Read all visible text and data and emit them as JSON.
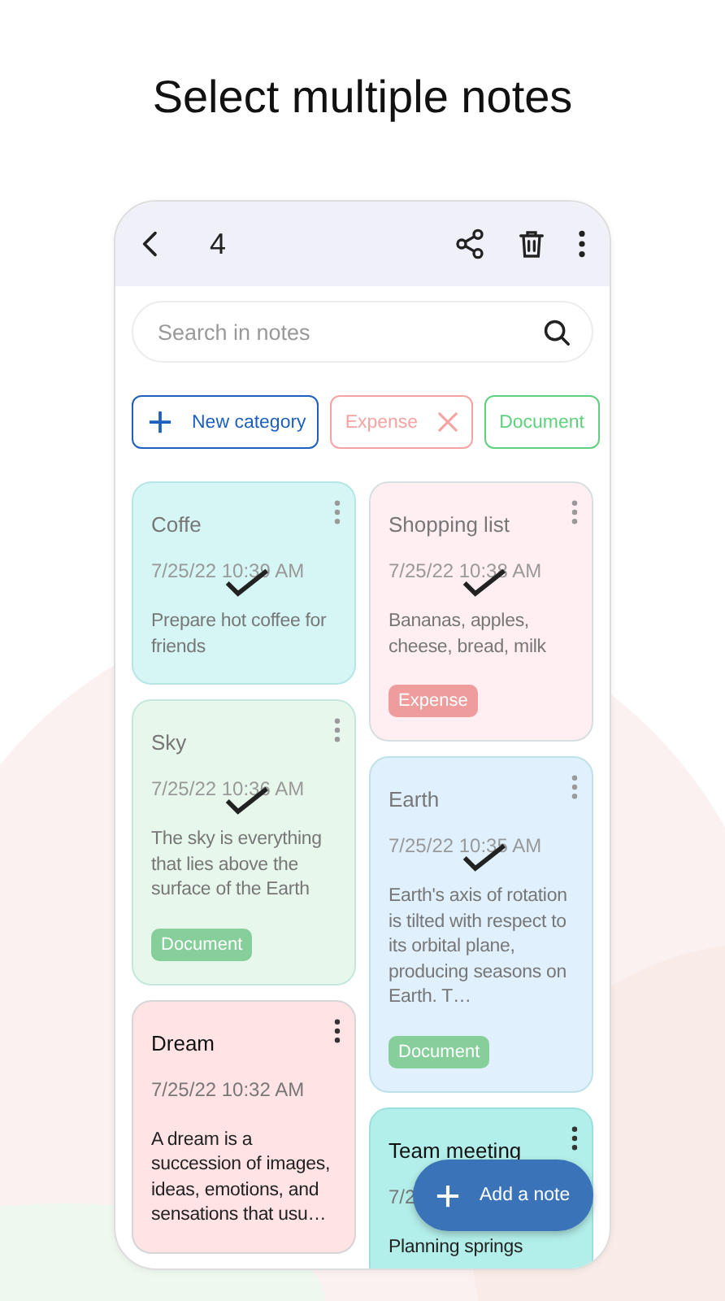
{
  "heading": "Select multiple notes",
  "toolbar": {
    "count": "4"
  },
  "search": {
    "placeholder": "Search in notes"
  },
  "categories": [
    {
      "kind": "new",
      "label": "New category"
    },
    {
      "kind": "tag",
      "label": "Expense",
      "color": "#f5a3a3",
      "removable": true
    },
    {
      "kind": "tag",
      "label": "Document",
      "color": "#5fd07e",
      "removable": false
    }
  ],
  "note_columns": [
    {
      "notes": [
        {
          "title": "Coffe",
          "date": "7/25/22 10:39 AM",
          "body": "Prepare hot coffee for friends",
          "color": "#d6f5f5",
          "selected": true
        },
        {
          "title": "Sky",
          "date": "7/25/22 10:36 AM",
          "body": "The sky is everything that lies above the surface of the Earth",
          "color": "#e8f7ec",
          "selected": true,
          "tag": {
            "label": "Document",
            "color": "#86cf9b"
          }
        },
        {
          "title": "Dream",
          "date": "7/25/22 10:32 AM",
          "body": "A dream is a succession of images, ideas, emotions, and sensations that usu…",
          "color": "#ffe3e5",
          "selected": false
        }
      ]
    },
    {
      "notes": [
        {
          "title": "Shopping list",
          "date": "7/25/22 10:38 AM",
          "body": "Bananas, apples, cheese, bread, milk",
          "color": "#ffeef2",
          "selected": true,
          "tag": {
            "label": "Expense",
            "color": "#ee9c9c"
          }
        },
        {
          "title": "Earth",
          "date": "7/25/22 10:35 AM",
          "body": "Earth's axis of rotation is tilted with respect to its orbital plane, producing seasons on Earth. T…",
          "color": "#e0f0fc",
          "selected": true,
          "tag": {
            "label": "Document",
            "color": "#86cf9b"
          }
        },
        {
          "title": "Team meeting",
          "date": "7/2",
          "body": "Planning springs",
          "color": "#b3efea",
          "selected": false
        }
      ]
    }
  ],
  "fab": {
    "label": "Add a note"
  }
}
